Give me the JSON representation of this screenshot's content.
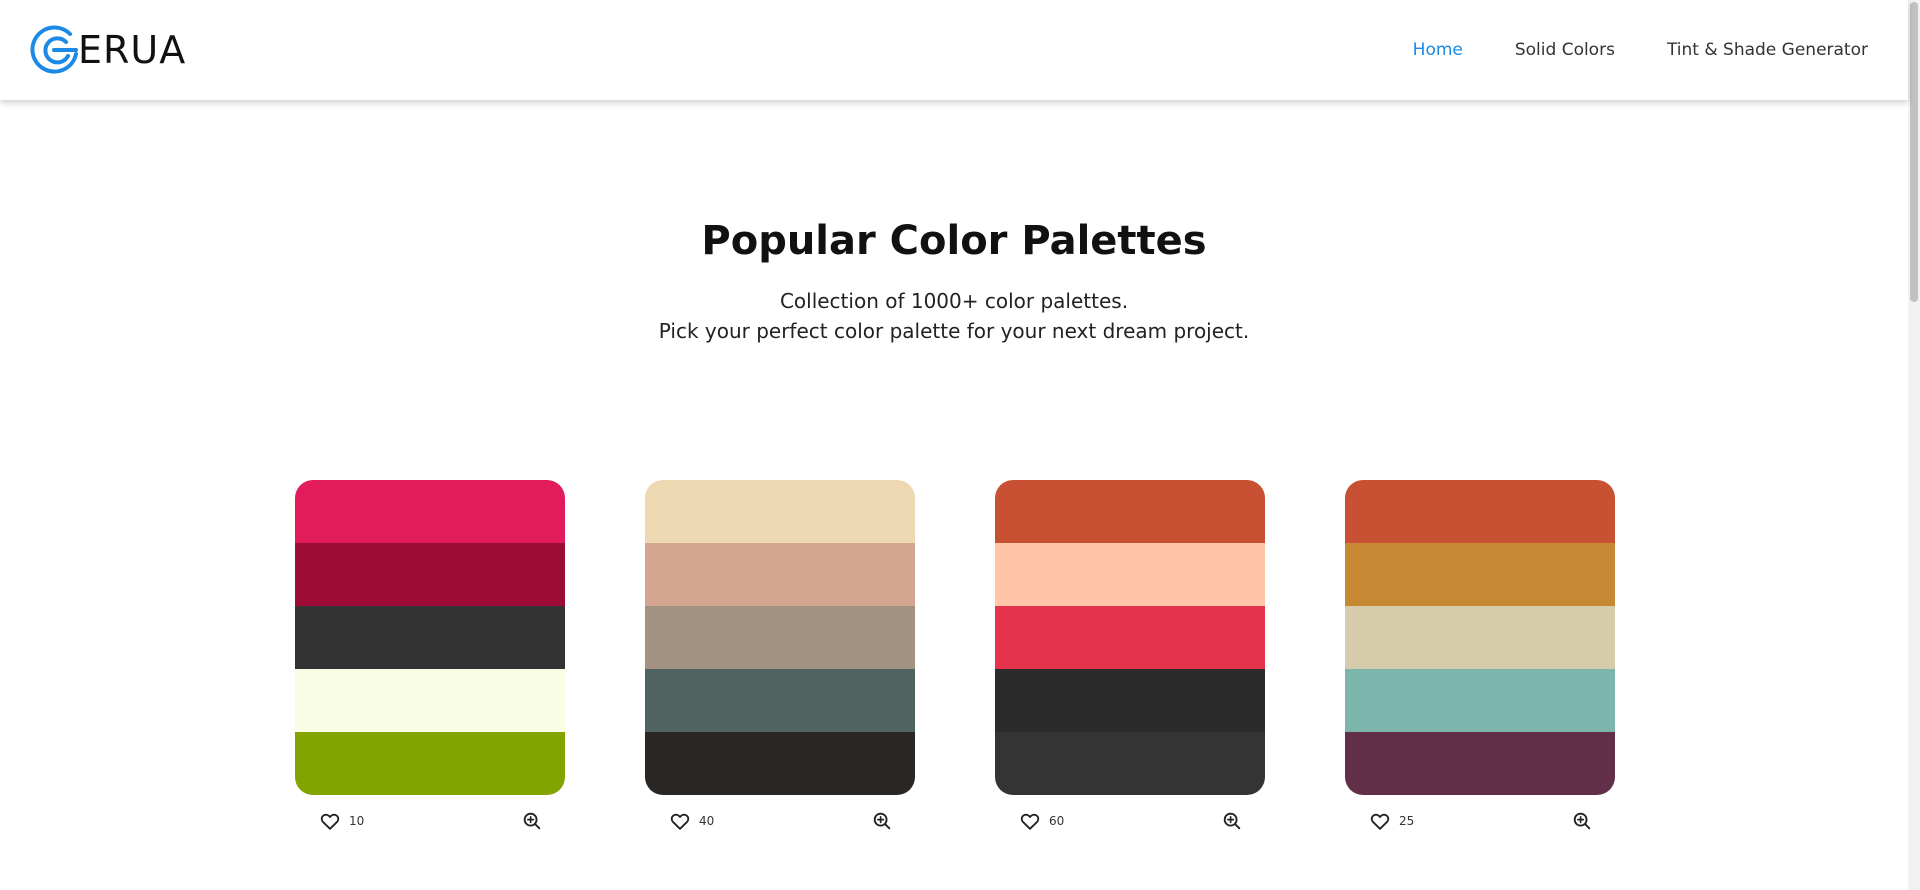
{
  "header": {
    "logo_text": "ERUA",
    "nav": [
      {
        "label": "Home",
        "active": true
      },
      {
        "label": "Solid Colors",
        "active": false
      },
      {
        "label": "Tint & Shade Generator",
        "active": false
      }
    ],
    "accent_color": "#1a8ae6"
  },
  "hero": {
    "title": "Popular Color Palettes",
    "subtitle_line1": "Collection of 1000+ color palettes.",
    "subtitle_line2": "Pick your perfect color palette for your next dream project."
  },
  "palettes": [
    {
      "colors": [
        "#e21c5a",
        "#9d0b37",
        "#333333",
        "#f9fde3",
        "#82a300"
      ],
      "likes": "10",
      "icons": [
        "heart-icon",
        "zoom-in-icon"
      ]
    },
    {
      "colors": [
        "#eed8b2",
        "#d4a691",
        "#a39182",
        "#4f6361",
        "#292624"
      ],
      "likes": "40",
      "icons": [
        "heart-icon",
        "zoom-in-icon"
      ]
    },
    {
      "colors": [
        "#c95133",
        "#ffc5a6",
        "#e5324d",
        "#2b2b2b",
        "#343434"
      ],
      "likes": "60",
      "icons": [
        "heart-icon",
        "zoom-in-icon"
      ]
    },
    {
      "colors": [
        "#c95133",
        "#c88934",
        "#d6ccab",
        "#7bb5ab",
        "#612f47"
      ],
      "likes": "25",
      "icons": [
        "heart-icon",
        "zoom-in-icon"
      ]
    }
  ]
}
